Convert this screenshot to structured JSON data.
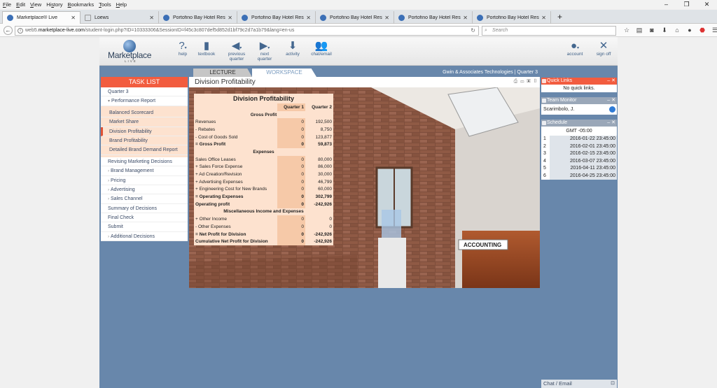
{
  "browser": {
    "menu": [
      {
        "pre": "",
        "key": "F",
        "post": "ile"
      },
      {
        "pre": "",
        "key": "E",
        "post": "dit"
      },
      {
        "pre": "",
        "key": "V",
        "post": "iew"
      },
      {
        "pre": "Hi",
        "key": "s",
        "post": "tory"
      },
      {
        "pre": "",
        "key": "B",
        "post": "ookmarks"
      },
      {
        "pre": "",
        "key": "T",
        "post": "ools"
      },
      {
        "pre": "",
        "key": "H",
        "post": "elp"
      }
    ],
    "tabs": [
      {
        "title": "Marketplace® Live",
        "active": true
      },
      {
        "title": "Loews",
        "active": false
      },
      {
        "title": "Portofino Bay Hotel Resta...",
        "active": false
      },
      {
        "title": "Portofino Bay Hotel Resta...",
        "active": false
      },
      {
        "title": "Portofino Bay Hotel Resta...",
        "active": false
      },
      {
        "title": "Portofino Bay Hotel Resta...",
        "active": false
      },
      {
        "title": "Portofino Bay Hotel Resta...",
        "active": false
      }
    ],
    "url_prefix": "web5.",
    "url_domain": "marketplace-live.com",
    "url_rest": "/student-login.php?ID=10333306&SessionID=f45c3c807def5d852d1bf79c2d7a1b79&lang=en-us",
    "search_placeholder": "Search"
  },
  "header": {
    "logo_text": "Marketplace",
    "logo_sub": "LIVE",
    "buttons": {
      "help": "help",
      "textbook": "textbook",
      "prev_1": "previous",
      "prev_2": "quarter",
      "next_1": "next",
      "next_2": "quarter",
      "activity": "activity",
      "chat": "chat/email",
      "account": "account",
      "signoff": "sign off"
    }
  },
  "tabs": {
    "lecture": "LECTURE",
    "workspace": "WORKSPACE"
  },
  "company": "Gwin & Associates Technologies  |  Quarter 3",
  "tasklist": {
    "header": "TASK LIST",
    "items": [
      {
        "label": "Quarter 3",
        "type": "top",
        "arrow": ""
      },
      {
        "label": "Performance Report",
        "type": "top",
        "arrow": "▾"
      },
      {
        "label": "Balanced Scorecard",
        "type": "sub",
        "arrow": ""
      },
      {
        "label": "Market Share",
        "type": "sub",
        "arrow": ""
      },
      {
        "label": "Division Profitability",
        "type": "sub-sel",
        "arrow": ""
      },
      {
        "label": "Brand Profitability",
        "type": "sub",
        "arrow": ""
      },
      {
        "label": "Detailed Brand Demand Report",
        "type": "sub",
        "arrow": ""
      },
      {
        "label": "Revising Marketing Decisions",
        "type": "top",
        "arrow": ""
      },
      {
        "label": "Brand Management",
        "type": "top",
        "arrow": "›"
      },
      {
        "label": "Pricing",
        "type": "top",
        "arrow": "›"
      },
      {
        "label": "Advertising",
        "type": "top",
        "arrow": "›"
      },
      {
        "label": "Sales Channel",
        "type": "top",
        "arrow": "›"
      },
      {
        "label": "Summary of Decisions",
        "type": "top",
        "arrow": ""
      },
      {
        "label": "Final Check",
        "type": "top",
        "arrow": ""
      },
      {
        "label": "Submit",
        "type": "top",
        "arrow": ""
      },
      {
        "label": "Additional Decisions",
        "type": "top",
        "arrow": "›"
      }
    ]
  },
  "workspace": {
    "title": "Division Profitability",
    "scene_sign": "ACCOUNTING"
  },
  "report": {
    "title": "Division Profitability",
    "columns": [
      "Quarter 1",
      "Quarter 2"
    ],
    "rows": [
      {
        "type": "section",
        "label": "Gross Profit"
      },
      {
        "type": "row",
        "label": "Revenues",
        "q1": "0",
        "q2": "192,500"
      },
      {
        "type": "row",
        "label": "- Rebates",
        "q1": "0",
        "q2": "8,750"
      },
      {
        "type": "row",
        "label": "- Cost of Goods Sold",
        "q1": "0",
        "q2": "123,877"
      },
      {
        "type": "bold",
        "label": "= Gross Profit",
        "q1": "0",
        "q2": "59,873"
      },
      {
        "type": "section",
        "label": "Expenses"
      },
      {
        "type": "row",
        "label": "Sales Office Leases",
        "q1": "0",
        "q2": "80,000"
      },
      {
        "type": "row",
        "label": "+ Sales Force Expense",
        "q1": "0",
        "q2": "86,000"
      },
      {
        "type": "row",
        "label": "+ Ad Creation/Revision",
        "q1": "0",
        "q2": "30,000"
      },
      {
        "type": "row",
        "label": "+ Advertising Expenses",
        "q1": "0",
        "q2": "46,799"
      },
      {
        "type": "row",
        "label": "+ Engineering Cost for New Brands",
        "q1": "0",
        "q2": "60,000"
      },
      {
        "type": "bold",
        "label": "= Operating Expenses",
        "q1": "0",
        "q2": "302,799"
      },
      {
        "type": "bold",
        "label": "Operating profit",
        "q1": "0",
        "q2": "-242,926"
      },
      {
        "type": "section",
        "label": "Miscellaneous Income and Expenses"
      },
      {
        "type": "row",
        "label": "+ Other Income",
        "q1": "0",
        "q2": "0"
      },
      {
        "type": "row",
        "label": "- Other Expenses",
        "q1": "0",
        "q2": "0"
      },
      {
        "type": "bold",
        "label": "= Net Profit for Division",
        "q1": "0",
        "q2": "-242,926"
      },
      {
        "type": "bold",
        "label": "Cumulative Net Profit for Division",
        "q1": "0",
        "q2": "-242,926"
      }
    ]
  },
  "quick_links": {
    "title": "Quick Links",
    "body": "No quick links."
  },
  "team_monitor": {
    "title": "Team Monitor",
    "member": "Scarimbolo, J."
  },
  "schedule": {
    "title": "Schedule",
    "timezone": "GMT -05:00",
    "rows": [
      {
        "n": "1",
        "date": "2016-01-22 23:45:00"
      },
      {
        "n": "2",
        "date": "2016-02-01 23:45:00"
      },
      {
        "n": "3",
        "date": "2016-02-15 23:45:00"
      },
      {
        "n": "4",
        "date": "2016-03-07 23:45:00"
      },
      {
        "n": "5",
        "date": "2016-04-11 23:45:00"
      },
      {
        "n": "6",
        "date": "2016-04-25 23:45:00"
      }
    ]
  },
  "chat": {
    "label": "Chat / Email"
  },
  "colors": {
    "accent": "#f25c3f",
    "app_bg": "#6887ab",
    "row_bg": "#fde2cf"
  },
  "icons": [
    "help-icon",
    "textbook-icon",
    "prev-arrow-icon",
    "next-arrow-icon",
    "activity-icon",
    "chat-icon",
    "account-icon",
    "signoff-icon"
  ]
}
